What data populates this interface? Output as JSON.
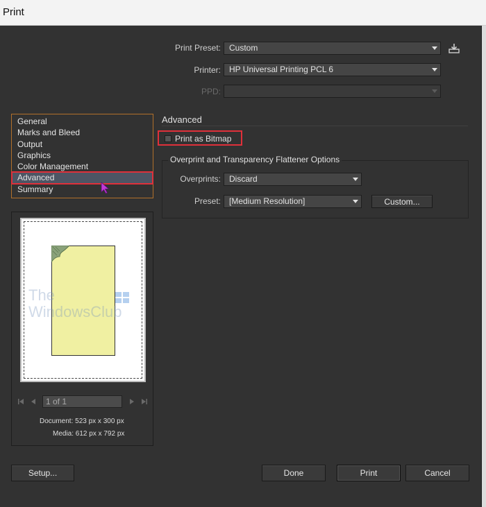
{
  "window": {
    "title": "Print"
  },
  "top_fields": {
    "print_preset": {
      "label": "Print Preset:",
      "value": "Custom"
    },
    "printer": {
      "label": "Printer:",
      "value": "HP Universal Printing PCL 6"
    },
    "ppd": {
      "label": "PPD:",
      "value": ""
    }
  },
  "categories": {
    "items": [
      "General",
      "Marks and Bleed",
      "Output",
      "Graphics",
      "Color Management",
      "Advanced",
      "Summary"
    ],
    "selected": "Advanced"
  },
  "preview": {
    "page_field": "1 of 1",
    "document": "Document: 523 px x 300 px",
    "media": "Media: 612 px x 792 px",
    "watermark_line1": "The",
    "watermark_line2": "WindowsClub"
  },
  "advanced": {
    "title": "Advanced",
    "print_as_bitmap": {
      "label": "Print as Bitmap",
      "checked": false
    },
    "group_title": "Overprint and Transparency Flattener Options",
    "overprints": {
      "label": "Overprints:",
      "value": "Discard"
    },
    "preset": {
      "label": "Preset:",
      "value": "[Medium Resolution]"
    },
    "custom_button": "Custom..."
  },
  "buttons": {
    "setup": "Setup...",
    "done": "Done",
    "print": "Print",
    "cancel": "Cancel"
  },
  "icons": {
    "save_preset": "save-preset-icon",
    "cursor": "mouse-pointer-icon",
    "first_page": "first-page-icon",
    "prev_page": "prev-page-icon",
    "next_page": "next-page-icon",
    "last_page": "last-page-icon"
  },
  "colors": {
    "selection_highlight": "#e0303a",
    "list_border": "#b3712a",
    "selected_item_bg": "#4d5564",
    "artboard_fill": "#f0f0a2"
  }
}
